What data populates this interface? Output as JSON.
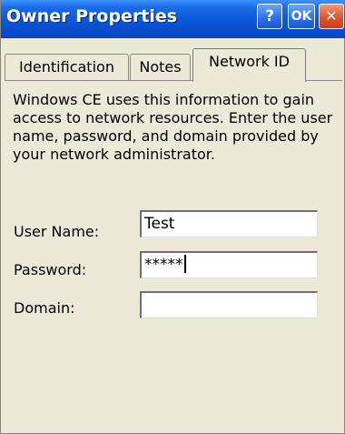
{
  "window": {
    "title": "Owner Properties",
    "help_label": "?",
    "ok_label": "OK",
    "close_label": "✕"
  },
  "tabs": [
    {
      "label": "Identification",
      "selected": false
    },
    {
      "label": "Notes",
      "selected": false
    },
    {
      "label": "Network ID",
      "selected": true
    }
  ],
  "content": {
    "description": "Windows CE uses this information to gain access to network resources. Enter the user name, password, and domain provided by your network administrator.",
    "fields": {
      "user_name": {
        "label": "User Name:",
        "value": "Test"
      },
      "password": {
        "label": "Password:",
        "value": "*****"
      },
      "domain": {
        "label": "Domain:",
        "value": ""
      }
    }
  }
}
